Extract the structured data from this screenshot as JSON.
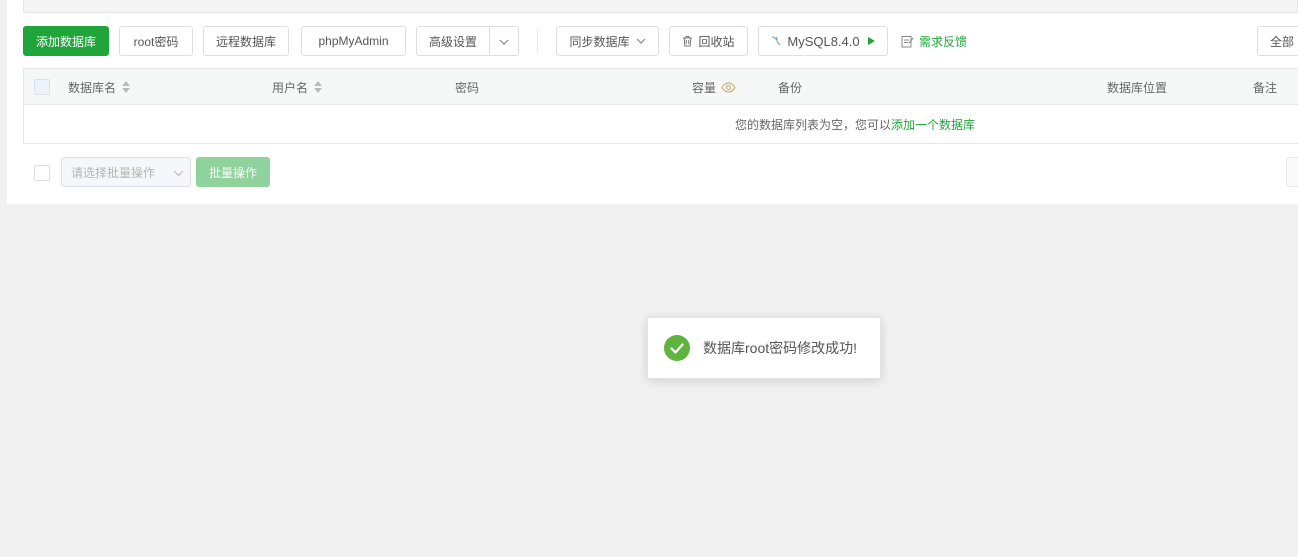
{
  "toolbar": {
    "add_db": "添加数据库",
    "root_pwd": "root密码",
    "remote_db": "远程数据库",
    "phpmyadmin": "phpMyAdmin",
    "advanced": "高级设置",
    "sync_db": "同步数据库",
    "recycle": "回收站",
    "mysql_version": "MySQL8.4.0",
    "feedback": "需求反馈",
    "filter_all": "全部"
  },
  "table": {
    "columns": [
      "数据库名",
      "用户名",
      "密码",
      "容量",
      "备份",
      "数据库位置",
      "备注"
    ],
    "empty_prefix": "您的数据库列表为空，您可以",
    "empty_link": "添加一个数据库"
  },
  "footer": {
    "batch_placeholder": "请选择批量操作",
    "batch_button": "批量操作"
  },
  "toast": {
    "message": "数据库root密码修改成功!",
    "status_color": "#5fb33f"
  },
  "colors": {
    "accent": "#20a53a"
  },
  "icons": {
    "advanced_dropdown": "chevron-down-icon",
    "sync_dropdown": "chevron-down-icon",
    "recycle": "trash-icon",
    "mysql": "mysql-dolphin-icon",
    "mysql_action": "play-icon",
    "feedback": "edit-note-icon",
    "capacity_hint": "eye-icon",
    "toast_status": "check-circle-icon"
  }
}
